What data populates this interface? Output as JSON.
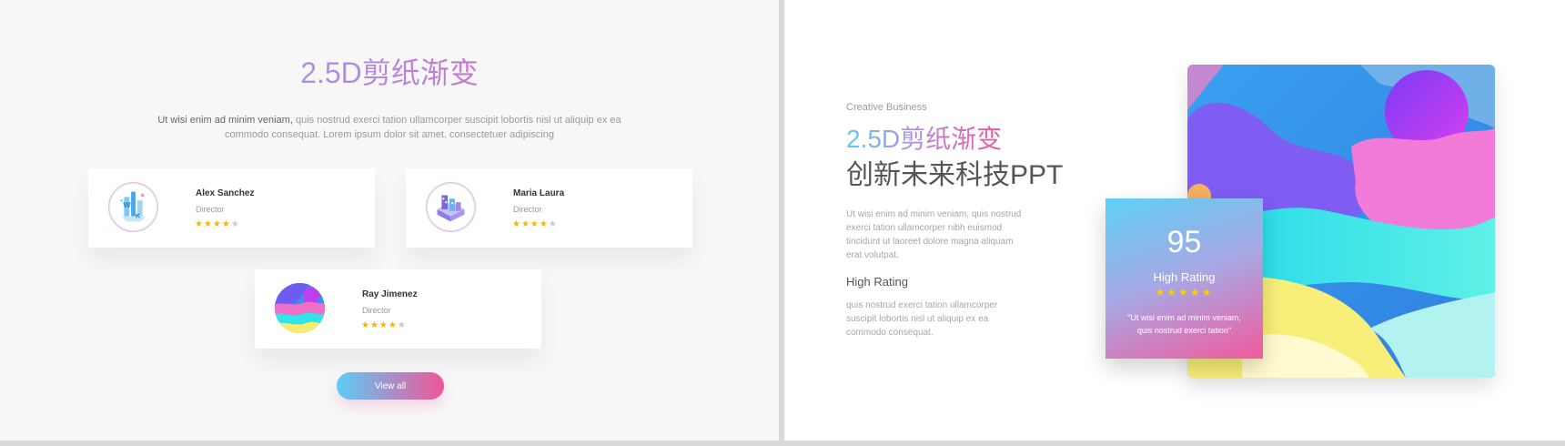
{
  "left": {
    "title": "2.5D剪纸渐变",
    "intro_emphasis": "Ut wisi enim ad minim veniam,",
    "intro_rest": " quis nostrud exerci tation ullamcorper suscipit lobortis nisl ut aliquip ex ea commodo consequat. Lorem ipsum dolor sit amet, consectetuer adipiscing",
    "members": [
      {
        "name": "Alex Sanchez",
        "role": "Director",
        "stars_on": "★★★★",
        "stars_off": "★",
        "rating": 4,
        "icon": "work-illustration-icon"
      },
      {
        "name": "Maria Laura",
        "role": "Director",
        "stars_on": "★★★★",
        "stars_off": "★",
        "rating": 4,
        "icon": "isometric-building-icon"
      },
      {
        "name": "Ray Jimenez",
        "role": "Director",
        "stars_on": "★★★★",
        "stars_off": "★",
        "rating": 4,
        "icon": "papercut-waves-icon"
      }
    ],
    "view_all_label": "View all"
  },
  "right": {
    "kicker": "Creative Business",
    "title_line1": "2.5D剪纸渐变",
    "title_line2": "创新未来科技PPT",
    "body1": "Ut wisi enim ad minim veniam, quis nostrud exerci tation ullamcorper nibh euismod tincidunt ut laoreet dolore magna aliquam erat volutpat.",
    "subheading": "High Rating",
    "body2": "quis nostrud exerci tation ullamcorper suscipit lobortis nisl ut aliquip ex ea commodo consequat.",
    "rating_card": {
      "score": "95",
      "label": "High Rating",
      "stars": "★★★★★",
      "quote": "\"Ut wisi enim ad minim veniam, quis nostrud exerci tation\""
    }
  },
  "colors": {
    "gradient_start": "#5bcdf5",
    "gradient_mid": "#b48ae0",
    "gradient_end": "#f0559a",
    "star": "#f7b500",
    "star_off": "#c8c8c8"
  }
}
